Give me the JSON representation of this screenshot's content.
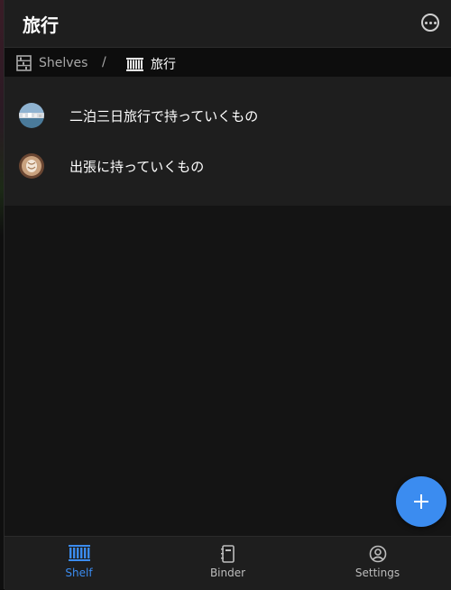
{
  "header": {
    "title": "旅行"
  },
  "breadcrumb": {
    "root_label": "Shelves",
    "separator": "/",
    "current_label": "旅行"
  },
  "list": {
    "items": [
      {
        "label": "二泊三日旅行で持っていくもの",
        "thumb": "landscape-thumbnail"
      },
      {
        "label": "出張に持っていくもの",
        "thumb": "latte-art-thumbnail"
      }
    ]
  },
  "fab": {
    "symbol": "+"
  },
  "tabs": [
    {
      "label": "Shelf",
      "icon": "shelf-icon",
      "active": true
    },
    {
      "label": "Binder",
      "icon": "binder-icon",
      "active": false
    },
    {
      "label": "Settings",
      "icon": "settings-icon",
      "active": false
    }
  ],
  "colors": {
    "accent": "#3b8cf0",
    "background": "#141414",
    "surface": "#1e1e1e"
  }
}
